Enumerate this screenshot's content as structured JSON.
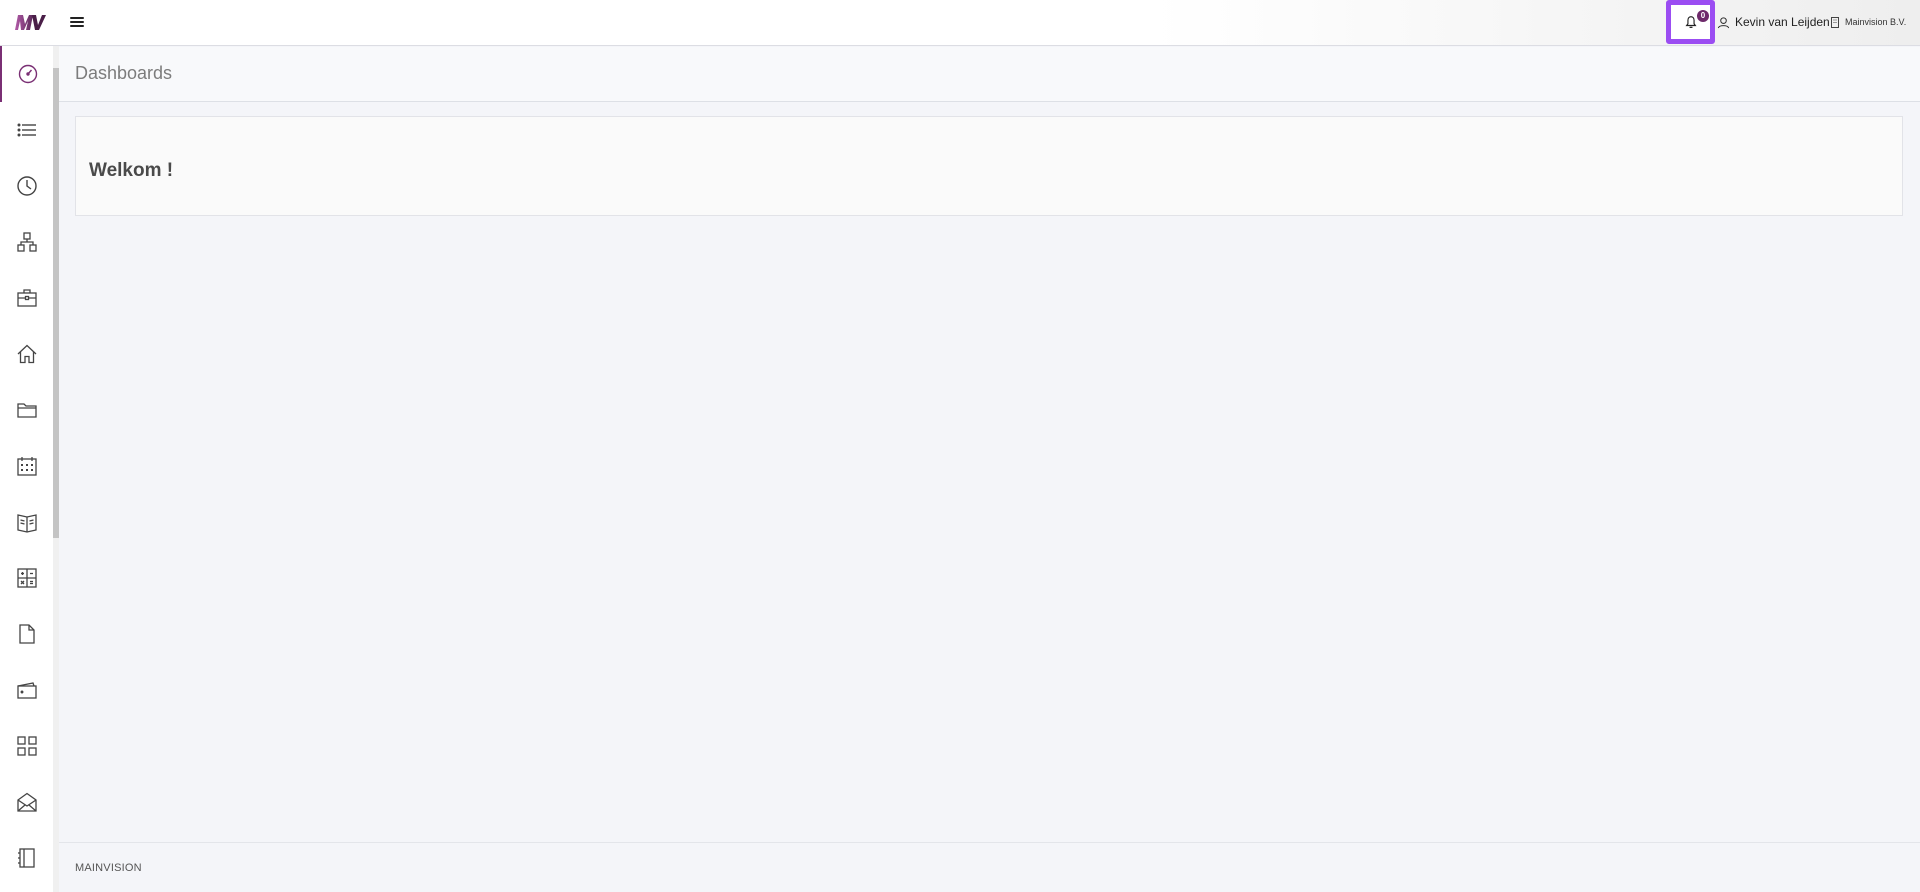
{
  "app": {
    "logo_text": "MV",
    "brand_color": "#7a2f74",
    "highlight_color": "#9b4df2"
  },
  "topbar": {
    "menu_icon": "hamburger-icon",
    "notifications": {
      "icon": "bell-icon",
      "count": "0"
    },
    "user": {
      "icon": "user-icon",
      "name": "Kevin van Leijden"
    },
    "company": {
      "icon": "building-icon",
      "name": "Mainvision B.V."
    }
  },
  "sidebar": {
    "items": [
      {
        "icon": "dashboard-gauge-icon",
        "active": true
      },
      {
        "icon": "list-icon"
      },
      {
        "icon": "clock-icon"
      },
      {
        "icon": "hierarchy-icon"
      },
      {
        "icon": "briefcase-icon"
      },
      {
        "icon": "home-icon"
      },
      {
        "icon": "folder-icon"
      },
      {
        "icon": "calendar-icon"
      },
      {
        "icon": "book-icon"
      },
      {
        "icon": "calculator-icon"
      },
      {
        "icon": "document-icon"
      },
      {
        "icon": "wallet-icon"
      },
      {
        "icon": "grid-icon"
      },
      {
        "icon": "envelope-open-icon"
      },
      {
        "icon": "notebook-icon"
      }
    ]
  },
  "page": {
    "title": "Dashboards",
    "welcome": "Welkom !"
  },
  "footer": {
    "text": "MAINVISION"
  }
}
